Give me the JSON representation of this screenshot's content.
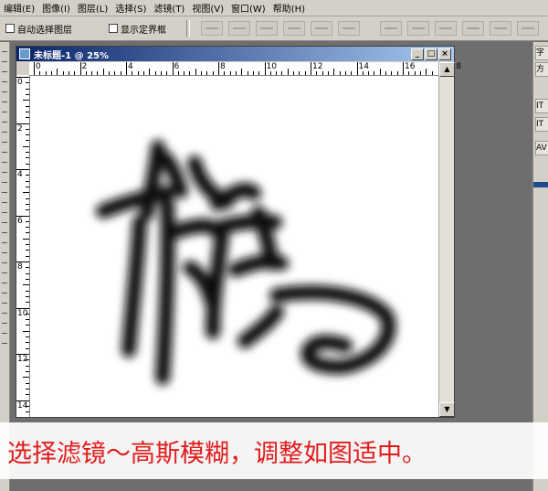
{
  "menu": [
    "编辑(E)",
    "图像(I)",
    "图层(L)",
    "选择(S)",
    "滤镜(T)",
    "视图(V)",
    "窗口(W)",
    "帮助(H)"
  ],
  "options": {
    "auto_select_layer": "自动选择图层",
    "show_bounding_box": "显示定界框"
  },
  "document": {
    "title": "未标题-1 @ 25%",
    "ruler_top": [
      "0",
      "2",
      "4",
      "6",
      "8",
      "10",
      "12",
      "14",
      "16",
      "18"
    ],
    "ruler_left": [
      "0",
      "2",
      "4",
      "6",
      "8",
      "10",
      "12",
      "14"
    ]
  },
  "right_panel": {
    "tabs": [
      "字",
      "方",
      "IT",
      "IT",
      "AV"
    ]
  },
  "caption": "选择滤镜～高斯模糊，调整如图适中。",
  "colors": {
    "caption_text": "#e21b1b",
    "titlebar_start": "#0a246a",
    "titlebar_end": "#a6caf0",
    "ui_face": "#d4d0c8"
  }
}
